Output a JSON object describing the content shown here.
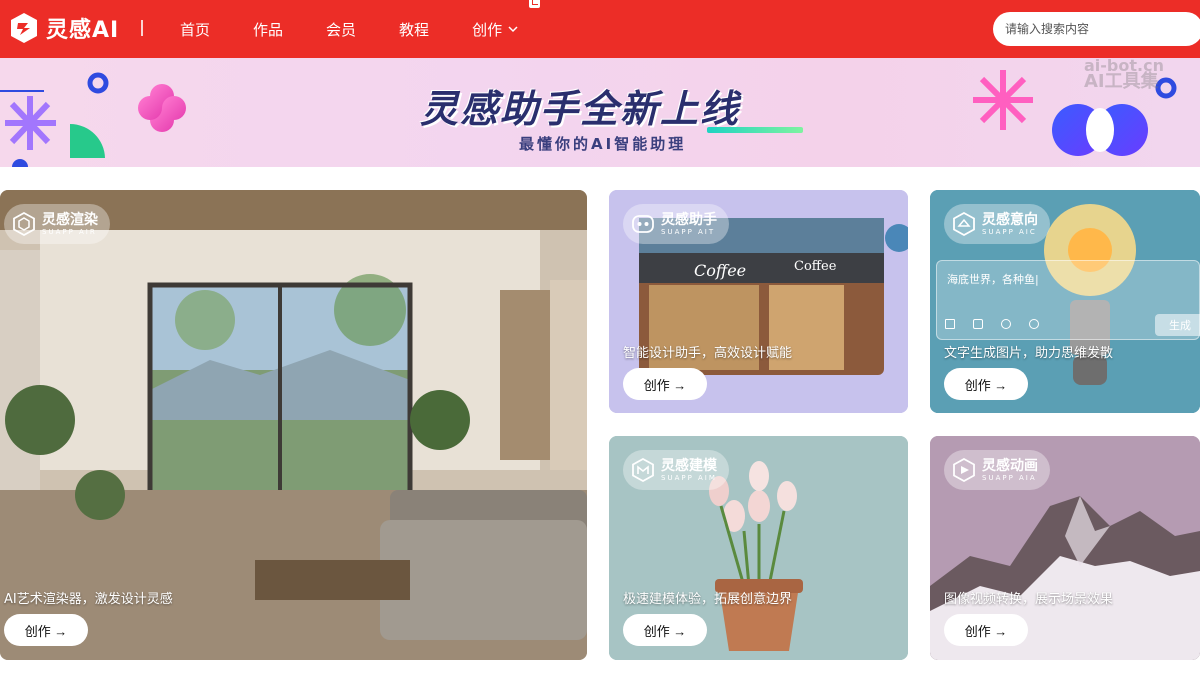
{
  "header": {
    "logo_text": "灵感AI",
    "nav": [
      {
        "label": "首页"
      },
      {
        "label": "作品"
      },
      {
        "label": "会员"
      },
      {
        "label": "教程"
      },
      {
        "label": "创作"
      }
    ],
    "search_placeholder": "请输入搜索内容"
  },
  "banner": {
    "title": "灵感助手全新上线",
    "subtitle": "最懂你的AI智能助理",
    "watermark_line1": "ai-bot.cn",
    "watermark_line2": "AI工具集"
  },
  "cards": [
    {
      "title": "灵感渲染",
      "sub": "SUAPP AIR",
      "desc": "AI艺术渲染器，激发设计灵感",
      "button": "创作 →",
      "icon": "render-icon"
    },
    {
      "title": "灵感助手",
      "sub": "SUAPP AIT",
      "desc": "智能设计助手，高效设计赋能",
      "button": "创作 →",
      "icon": "assistant-icon"
    },
    {
      "title": "灵感意向",
      "sub": "SUAPP AIC",
      "desc": "文字生成图片，助力思维发散",
      "button": "创作 →",
      "icon": "intent-icon",
      "input_text": "海底世界，各种鱼|",
      "generate_label": "生成"
    },
    {
      "title": "灵感建模",
      "sub": "SUAPP AIM",
      "desc": "极速建模体验，拓展创意边界",
      "button": "创作 →",
      "icon": "model-icon"
    },
    {
      "title": "灵感动画",
      "sub": "SUAPP AIA",
      "desc": "图像视频转换，展示场景效果",
      "button": "创作 →",
      "icon": "animation-icon"
    }
  ],
  "colors": {
    "brand": "#ec2d27",
    "banner_bg": "#f4d4ec",
    "navy": "#2a2f6e"
  }
}
